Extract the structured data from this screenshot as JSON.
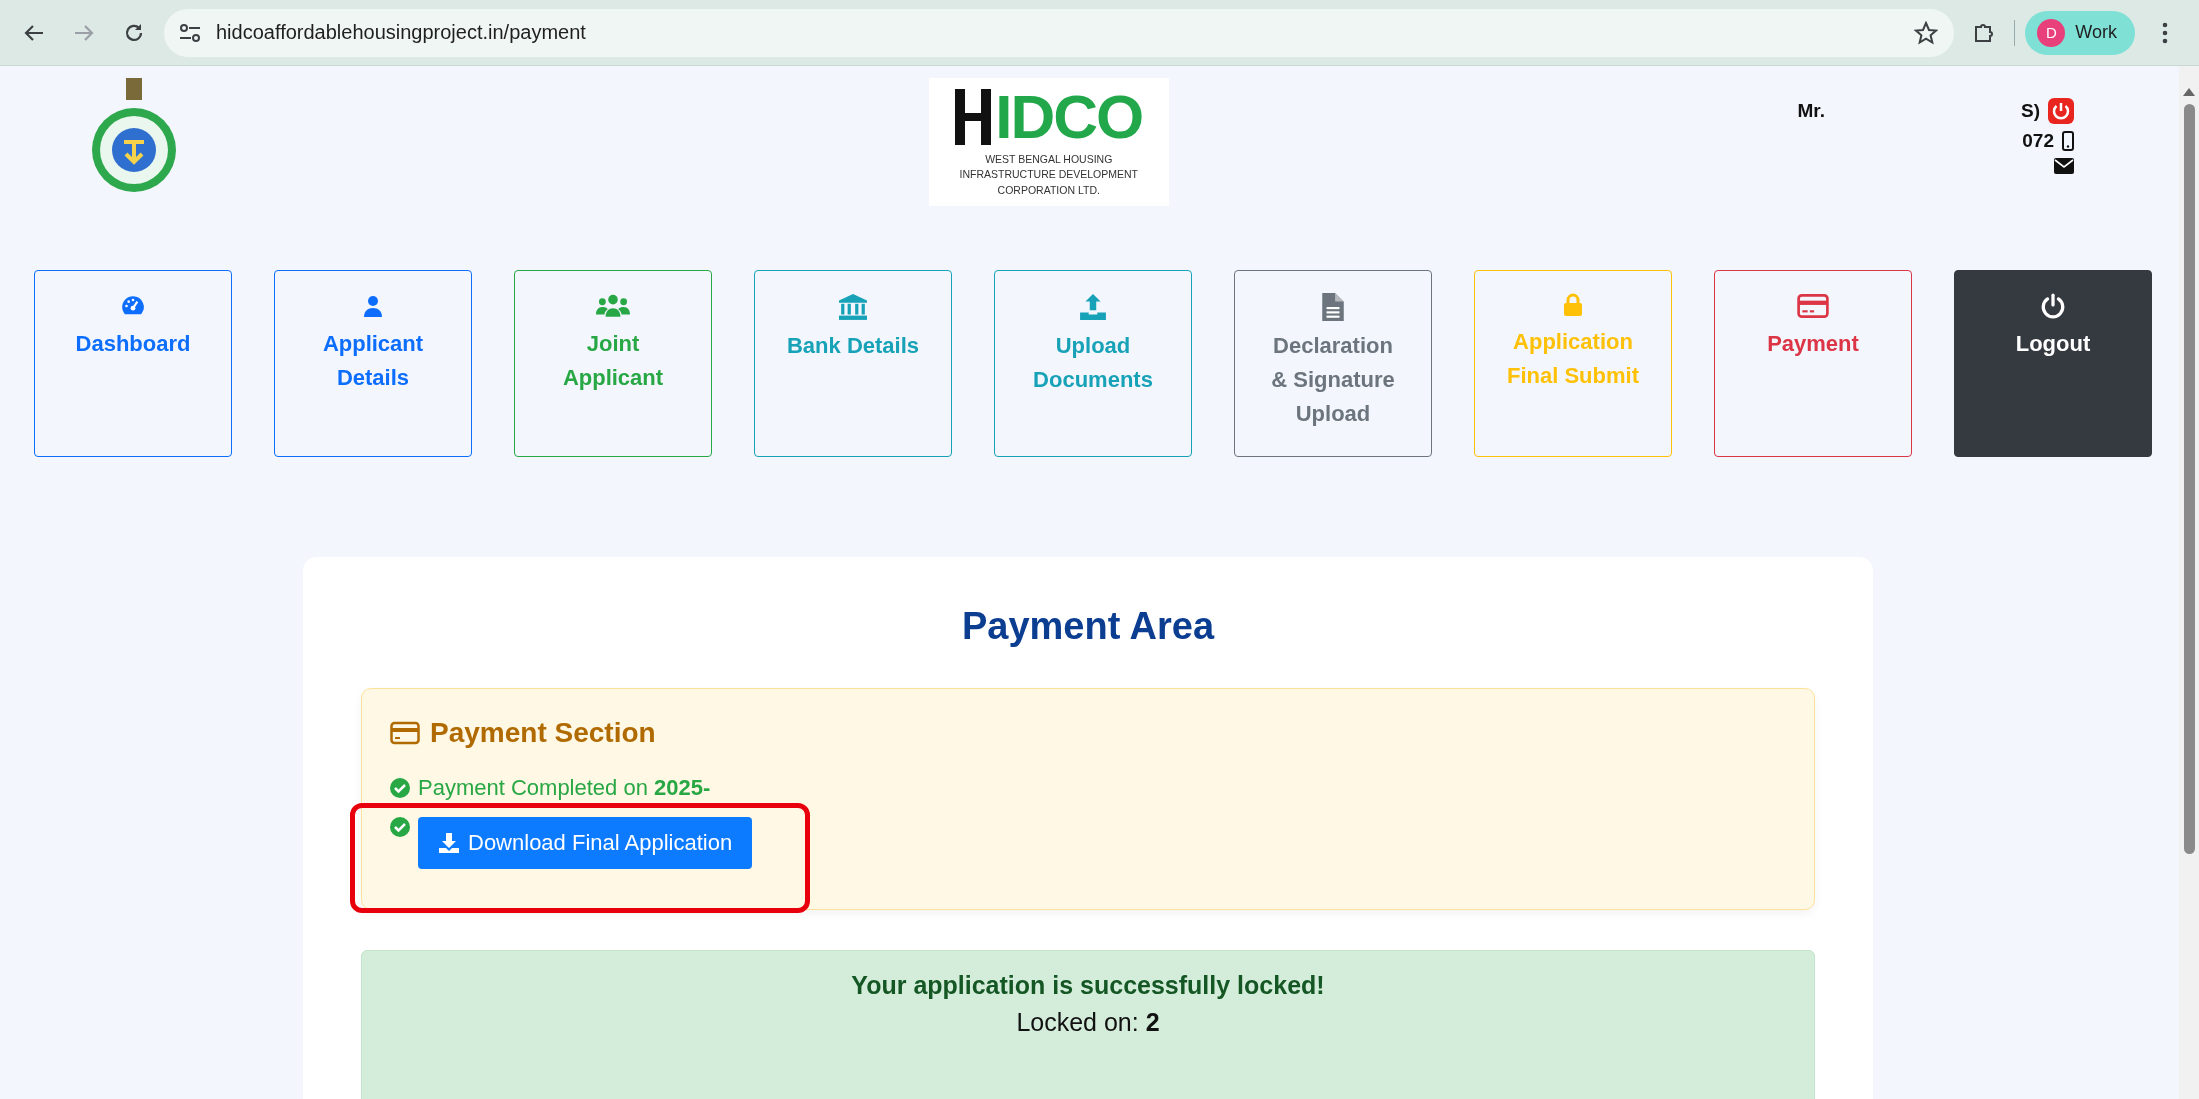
{
  "browser": {
    "url": "hidcoaffordablehousingproject.in/payment",
    "profile_initial": "D",
    "profile_name": "Work"
  },
  "header": {
    "logo_mark": "IDCO",
    "logo_caption": [
      "WEST BENGAL HOUSING",
      "INFRASTRUCTURE DEVELOPMENT",
      "CORPORATION LTD."
    ],
    "user_prefix": "Mr.",
    "user_suffix": "S)",
    "phone_tail": "072"
  },
  "nav": [
    {
      "label": "Dashboard",
      "kind": "outline",
      "color": "#0d6efd"
    },
    {
      "label": "Applicant Details",
      "kind": "outline",
      "color": "#0d6efd"
    },
    {
      "label": "Joint Applicant",
      "kind": "outline",
      "color": "#28a745"
    },
    {
      "label": "Bank Details",
      "kind": "outline",
      "color": "#17a2b8"
    },
    {
      "label": "Upload Documents",
      "kind": "outline",
      "color": "#17a2b8"
    },
    {
      "label": "Declaration & Signature Upload",
      "kind": "outline",
      "color": "#6c757d"
    },
    {
      "label": "Application Final Submit",
      "kind": "outline",
      "color": "#ffc107"
    },
    {
      "label": "Payment",
      "kind": "outline",
      "color": "#dc3545"
    },
    {
      "label": "Logout",
      "kind": "filled",
      "color": "#343a40"
    }
  ],
  "payment": {
    "title": "Payment Area",
    "section_title": "Payment Section",
    "completed_text": "Payment Completed on **2025-**",
    "download_button": "Download Final Application",
    "annotation_highlight": true,
    "lock_title": "Your application is successfully locked!",
    "locked_on": "Locked on: **2**"
  }
}
